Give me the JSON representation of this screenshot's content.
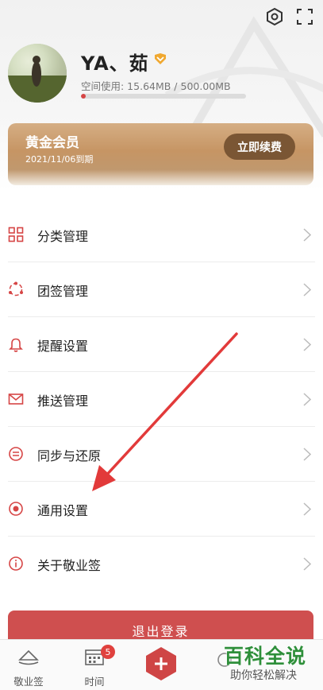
{
  "profile": {
    "username": "YA、茹",
    "space_label": "空间使用: 15.64MB / 500.00MB",
    "space_used_fraction": 0.031
  },
  "membership": {
    "title": "黄金会员",
    "expire": "2021/11/06到期",
    "renew_label": "立即续费"
  },
  "menu": [
    {
      "label": "分类管理",
      "icon": "grid-icon"
    },
    {
      "label": "团签管理",
      "icon": "team-icon"
    },
    {
      "label": "提醒设置",
      "icon": "bell-icon"
    },
    {
      "label": "推送管理",
      "icon": "mail-icon"
    },
    {
      "label": "同步与还原",
      "icon": "sync-icon"
    },
    {
      "label": "通用设置",
      "icon": "radio-icon"
    },
    {
      "label": "关于敬业签",
      "icon": "info-icon"
    }
  ],
  "logout_label": "退出登录",
  "tabbar": {
    "tab1_label": "敬业签",
    "tab2_label": "时间",
    "tab2_badge": "5"
  },
  "watermark": {
    "title": "百科全说",
    "subtitle": "助你轻松解决"
  },
  "colors": {
    "accent": "#cf4f4f",
    "gold": "#c69564",
    "renew_button": "#7a5634",
    "watermark_green": "#2e8f3a"
  }
}
